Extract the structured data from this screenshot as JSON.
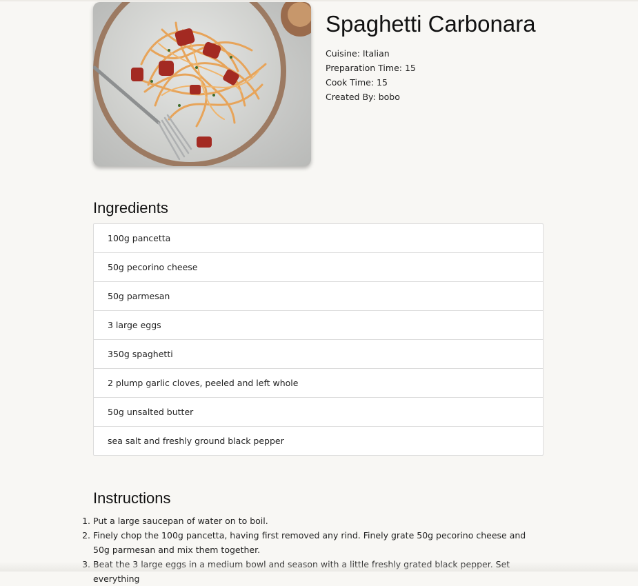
{
  "recipe": {
    "title": "Spaghetti Carbonara",
    "meta": {
      "cuisine": "Cuisine: Italian",
      "prep_time": "Preparation Time: 15",
      "cook_time": "Cook Time: 15",
      "created_by": "Created By: bobo"
    }
  },
  "ingredients": {
    "heading": "Ingredients",
    "items": [
      "100g pancetta",
      "50g pecorino cheese",
      "50g parmesan",
      "3 large eggs",
      "350g spaghetti",
      "2 plump garlic cloves, peeled and left whole",
      "50g unsalted butter",
      "sea salt and freshly ground black pepper"
    ]
  },
  "instructions": {
    "heading": "Instructions",
    "steps": [
      "Put a large saucepan of water on to boil.",
      "Finely chop the 100g pancetta, having first removed any rind. Finely grate 50g pecorino cheese and 50g parmesan and mix them together.",
      "Beat the 3 large eggs in a medium bowl and season with a little freshly grated black pepper. Set everything"
    ]
  }
}
